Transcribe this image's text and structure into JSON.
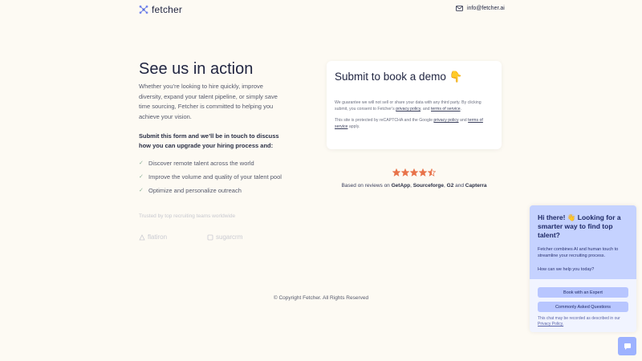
{
  "header": {
    "logo_text": "fetcher",
    "email": "info@fetcher.ai"
  },
  "hero": {
    "title": "See us in action",
    "intro": "Whether you’re looking to hire quickly, improve diversity, expand your talent pipeline, or simply save time sourcing, Fetcher is committed to helping you achieve your vision.",
    "lead": "Submit this form and we’ll be in touch to discuss how you can upgrade your hiring process and:",
    "benefits": [
      "Discover remote talent across the world",
      "Improve the volume and quality of your talent pool",
      "Optimize and personalize outreach"
    ],
    "trusted": "Trusted by top recruiting teams worldwide",
    "partners": [
      "flatiron",
      "sugarcrm"
    ]
  },
  "card": {
    "title": "Submit to book a demo 👇",
    "guarantee_text": "We guarantee we will not sell or share your data with any third party. By clicking submit, you consent to Fetcher’s",
    "privacy_link": "privacy policy",
    "and_text": "and",
    "terms_link": "terms of service",
    "recaptcha_text": "This site is protected by reCAPTCHA and the Google",
    "recaptcha_privacy_link": "privacy policy",
    "recaptcha_and": "and",
    "recaptcha_terms_link": "terms of service",
    "recaptcha_apply": "apply."
  },
  "reviews": {
    "rating": 4.5,
    "max_rating": 5,
    "based_on": "Based on reviews on",
    "site1": "GetApp",
    "site2": "Sourceforge",
    "site3": "G2",
    "and_text": "and",
    "site4": "Capterra"
  },
  "footer": {
    "copyright": "© Copyright Fetcher. All Rights Reserved"
  },
  "chat": {
    "heading": "Hi there! 👋 Looking for a smarter way to find top talent?",
    "body": "Fetcher combines AI and human touch to streamline your recruiting process.",
    "question": "How can we help you today?",
    "button_expert": "Book with an Expert",
    "button_faq": "Commonly Asked Questions",
    "note": "This chat may be recorded as described in our",
    "note_link": "Privacy Policy."
  },
  "colors": {
    "background": "#fdfaf3",
    "star": "#e8734a",
    "chat_header": "#c5d2ff",
    "chat_button": "#b8c6ff",
    "launcher": "#9db2ff"
  }
}
